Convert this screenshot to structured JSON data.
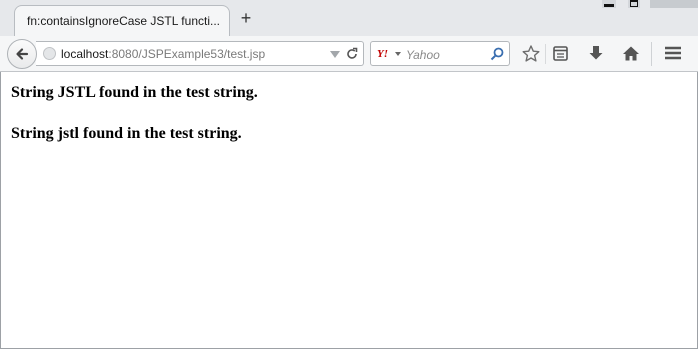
{
  "browser": {
    "tab_title": "fn:containsIgnoreCase JSTL functi...",
    "new_tab_label": "+",
    "url_host": "localhost",
    "url_rest": ":8080/JSPExample53/test.jsp",
    "search_engine": "Yahoo",
    "search_logo": "Y!",
    "search_placeholder": "Yahoo",
    "icons": [
      "back-arrow-icon",
      "globe-icon",
      "dropdown-icon",
      "reload-icon",
      "search-icon",
      "bookmark-star-icon",
      "reading-list-icon",
      "download-icon",
      "home-icon",
      "menu-icon"
    ]
  },
  "page": {
    "line1": "String JSTL found in the test string.",
    "line2": "String jstl found in the test string."
  },
  "colors": {
    "tabstrip": "#e6e8eb",
    "toolbar": "#f5f6f7",
    "yahoo": "#c10000"
  }
}
